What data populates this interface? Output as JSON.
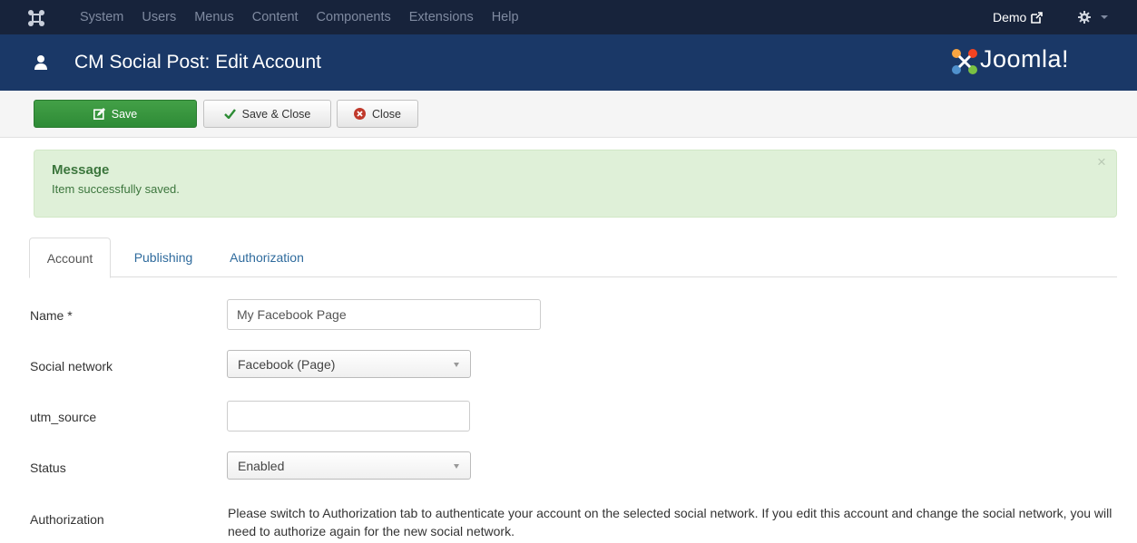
{
  "topnav": {
    "items": [
      "System",
      "Users",
      "Menus",
      "Content",
      "Components",
      "Extensions",
      "Help"
    ],
    "demo_label": "Demo"
  },
  "header": {
    "title": "CM Social Post: Edit Account",
    "brand": "Joomla!"
  },
  "toolbar": {
    "save_label": "Save",
    "save_close_label": "Save & Close",
    "close_label": "Close"
  },
  "message": {
    "heading": "Message",
    "text": "Item successfully saved.",
    "close_glyph": "×"
  },
  "tabs": [
    {
      "label": "Account",
      "active": true
    },
    {
      "label": "Publishing",
      "active": false
    },
    {
      "label": "Authorization",
      "active": false
    }
  ],
  "form": {
    "name": {
      "label": "Name *",
      "value": "My Facebook Page"
    },
    "social_network": {
      "label": "Social network",
      "value": "Facebook (Page)"
    },
    "utm_source": {
      "label": "utm_source",
      "value": ""
    },
    "status": {
      "label": "Status",
      "value": "Enabled"
    },
    "authorization": {
      "label": "Authorization",
      "text": "Please switch to Authorization tab to authenticate your account on the selected social network. If you edit this account and change the social network, you will need to authorize again for the new social network."
    }
  },
  "colors": {
    "topbar": "#17233b",
    "titlebar": "#1a3867",
    "save_button": "#2e8b36",
    "alert_bg": "#dff0d8",
    "alert_text": "#3c763d",
    "link": "#2f6b9d"
  },
  "icons": {
    "app_logo": "joomla-icon",
    "external": "external-link-icon",
    "settings": "gear-icon",
    "user": "user-icon",
    "save": "edit-icon",
    "save_close": "check-icon",
    "close": "remove-icon"
  }
}
